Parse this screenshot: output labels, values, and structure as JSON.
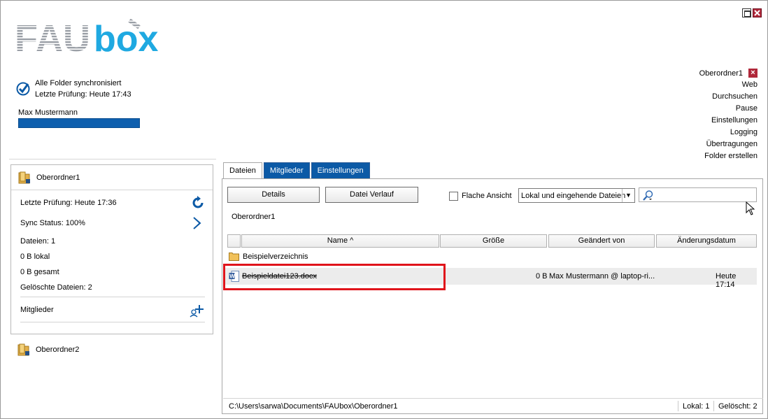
{
  "window": {
    "max_icon": "maximize-icon",
    "close_icon": "close-icon"
  },
  "logo": {
    "text_fau": "FAU",
    "text_box": "box"
  },
  "sync": {
    "status": "Alle Folder synchronisiert",
    "last_check": "Letzte Prüfung: Heute 17:43",
    "user": "Max Mustermann"
  },
  "right_menu": {
    "folder": "Oberordner1",
    "items": [
      "Web",
      "Durchsuchen",
      "Pause",
      "Einstellungen",
      "Logging",
      "Übertragungen",
      "Folder erstellen"
    ]
  },
  "card": {
    "title": "Oberordner1",
    "last_check": "Letzte Prüfung: Heute 17:36",
    "sync_status": "Sync Status: 100%",
    "files": "Dateien: 1",
    "local": "0 B lokal",
    "total": "0 B gesamt",
    "deleted": "Gelöschte Dateien: 2",
    "members": "Mitglieder"
  },
  "folder2": {
    "title": "Oberordner2"
  },
  "tabs": [
    "Dateien",
    "Mitglieder",
    "Einstellungen"
  ],
  "toolbar": {
    "details": "Details",
    "history": "Datei Verlauf",
    "flat_view": "Flache Ansicht",
    "filter_value": "Lokal und eingehende Dateien",
    "filter_arrow": "▼",
    "search_value": ""
  },
  "breadcrumb": "Oberordner1",
  "columns": [
    "Name ^",
    "Größe",
    "Geändert von",
    "Änderungsdatum"
  ],
  "rows": {
    "folder_name": "Beispielverzeichnis",
    "file": {
      "name": "Beispieldatei123.docx",
      "size": "0 B",
      "changed_by": "Max Mustermann @ laptop-ri...",
      "date": "Heute 17:14"
    }
  },
  "statusbar": {
    "path": "C:\\Users\\sarwa\\Documents\\FAUbox\\Oberordner1",
    "local": "Lokal: 1",
    "deleted": "Gelöscht: 2"
  },
  "colors": {
    "accent_blue": "#0c5aa6",
    "logo_cyan": "#1fa9e1",
    "highlight_red": "#e0141b"
  }
}
